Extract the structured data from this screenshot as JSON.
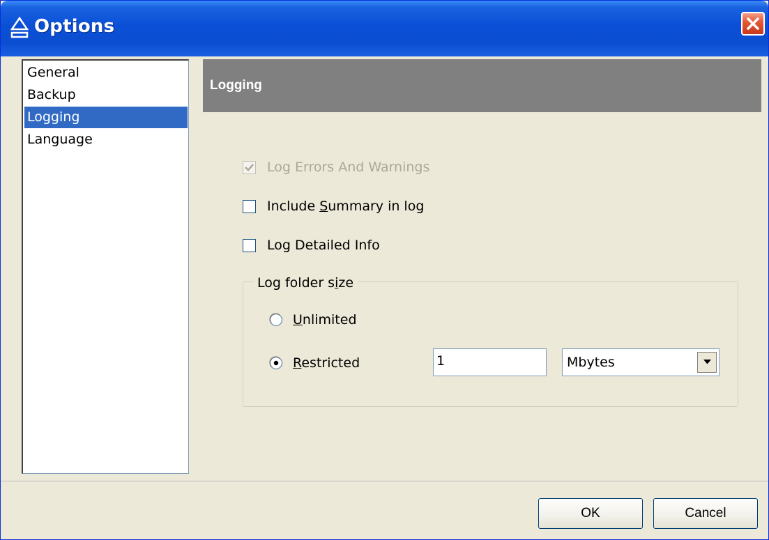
{
  "window": {
    "title": "Options"
  },
  "nav": {
    "items": [
      {
        "label": "General",
        "selected": false
      },
      {
        "label": "Backup",
        "selected": false
      },
      {
        "label": "Logging",
        "selected": true
      },
      {
        "label": "Language",
        "selected": false
      }
    ]
  },
  "panel": {
    "header": "Logging",
    "checkboxes": [
      {
        "label": "Log Errors And Warnings",
        "checked": true,
        "disabled": true
      },
      {
        "label_before": "Include ",
        "label_accel": "S",
        "label_after": "ummary in log",
        "checked": false,
        "disabled": false
      },
      {
        "label": "Log Detailed Info",
        "checked": false,
        "disabled": false
      }
    ],
    "log_folder_size": {
      "legend_before": "Log folder s",
      "legend_accel": "i",
      "legend_after": "ze",
      "unlimited": {
        "accel": "U",
        "rest": "nlimited",
        "selected": false
      },
      "restricted": {
        "accel": "R",
        "rest": "estricted",
        "selected": true
      },
      "size_value": "1",
      "unit": "Mbytes"
    }
  },
  "buttons": {
    "ok": "OK",
    "cancel": "Cancel"
  },
  "colors": {
    "selection": "#316ac5",
    "header_band": "#808080",
    "title_bar": "#0a4fd6"
  }
}
